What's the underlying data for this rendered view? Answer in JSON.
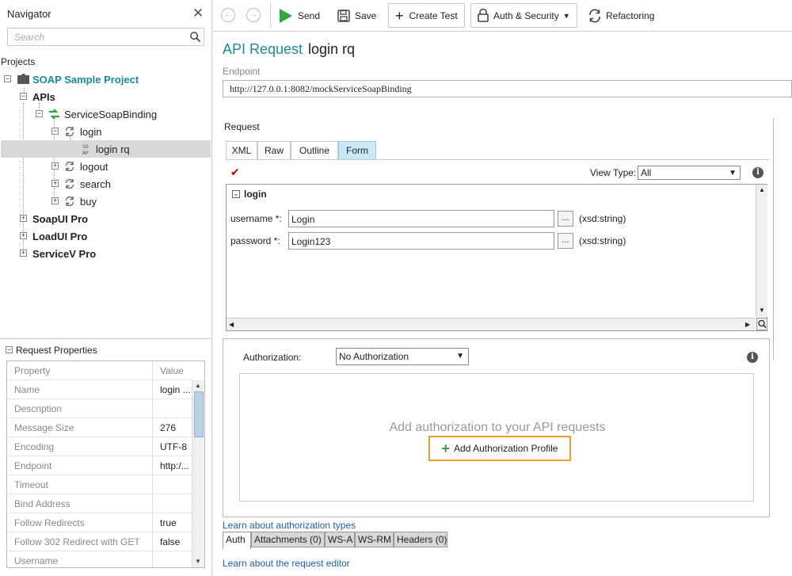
{
  "navigator": {
    "title": "Navigator",
    "search_placeholder": "Search",
    "projects_label": "Projects",
    "tree": {
      "project": "SOAP Sample Project",
      "apis": "APIs",
      "binding": "ServiceSoapBinding",
      "login": "login",
      "login_rq": "login rq",
      "logout": "logout",
      "search": "search",
      "buy": "buy",
      "soapui_pro": "SoapUI Pro",
      "loadui_pro": "LoadUI Pro",
      "servicev_pro": "ServiceV Pro"
    }
  },
  "request_properties": {
    "title": "Request Properties",
    "columns": [
      "Property",
      "Value"
    ],
    "rows": [
      {
        "name": "Name",
        "value": "login ..."
      },
      {
        "name": "Description",
        "value": ""
      },
      {
        "name": "Message Size",
        "value": "276"
      },
      {
        "name": "Encoding",
        "value": "UTF-8"
      },
      {
        "name": "Endpoint",
        "value": "http:/..."
      },
      {
        "name": "Timeout",
        "value": ""
      },
      {
        "name": "Bind Address",
        "value": ""
      },
      {
        "name": "Follow Redirects",
        "value": "true"
      },
      {
        "name": "Follow 302 Redirect with GET",
        "value": "false"
      },
      {
        "name": "Username",
        "value": ""
      }
    ]
  },
  "toolbar": {
    "send": "Send",
    "save": "Save",
    "create_test": "Create Test",
    "auth_security": "Auth & Security",
    "refactoring": "Refactoring"
  },
  "request": {
    "title": "API Request",
    "name": "login rq",
    "endpoint_label": "Endpoint",
    "endpoint": "http://127.0.0.1:8082/mockServiceSoapBinding",
    "section_label": "Request",
    "tabs": [
      "XML",
      "Raw",
      "Outline",
      "Form"
    ],
    "active_tab": "Form",
    "view_type_label": "View Type:",
    "view_type_value": "All",
    "form": {
      "section": "login",
      "fields": [
        {
          "label": "username *:",
          "value": "Login",
          "type": "(xsd:string)"
        },
        {
          "label": "password *:",
          "value": "Login123",
          "type": "(xsd:string)"
        }
      ]
    }
  },
  "authorization": {
    "label": "Authorization:",
    "selected": "No Authorization",
    "hint": "Add authorization to your API requests",
    "add_button": "Add Authorization Profile",
    "learn_link": "Learn about authorization types"
  },
  "bottom_tabs": [
    "Auth",
    "Attachments (0)",
    "WS-A",
    "WS-RM",
    "Headers (0)"
  ],
  "footer_link": "Learn about the request editor",
  "colors": {
    "accent": "#1a8a9a",
    "send_green": "#2eaa3a",
    "highlight_orange": "#f39c2d",
    "link_blue": "#1d5fa8"
  }
}
